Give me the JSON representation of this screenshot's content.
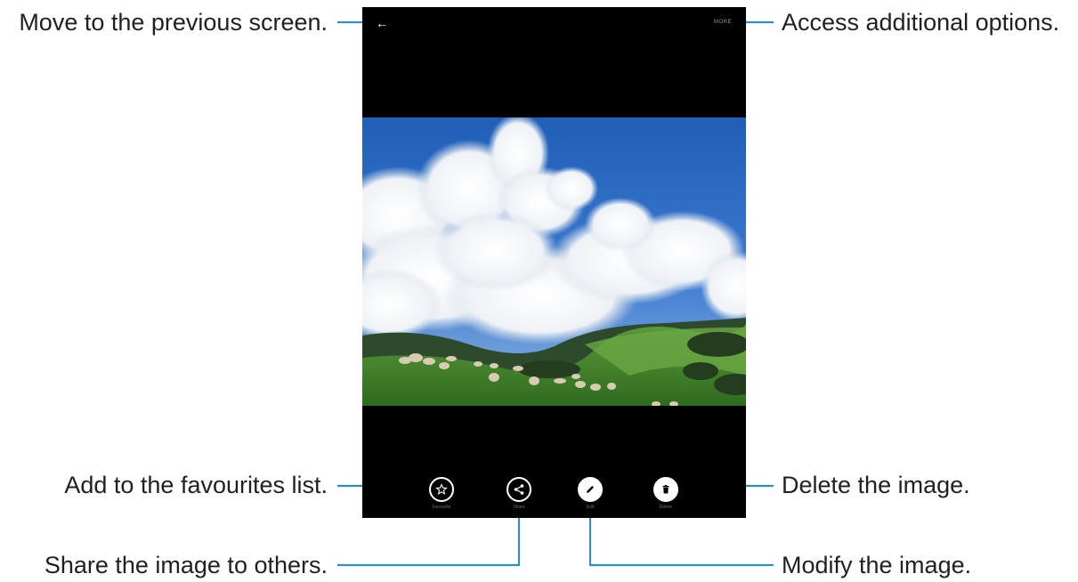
{
  "callouts": {
    "back": "Move to the previous screen.",
    "options": "Access additional options.",
    "favourites": "Add to the favourites list.",
    "delete": "Delete the image.",
    "share": "Share the image to others.",
    "modify": "Modify the image."
  },
  "screen": {
    "back_glyph": "←",
    "more_label": "MORE",
    "toolbar": [
      {
        "icon": "star-icon",
        "label": "Favourite"
      },
      {
        "icon": "share-icon",
        "label": "Share"
      },
      {
        "icon": "edit-icon",
        "label": "Edit"
      },
      {
        "icon": "delete-icon",
        "label": "Delete"
      }
    ]
  },
  "colors": {
    "callout_line": "#2b8fc9",
    "screen_bg": "#000000",
    "text": "#231f20"
  }
}
